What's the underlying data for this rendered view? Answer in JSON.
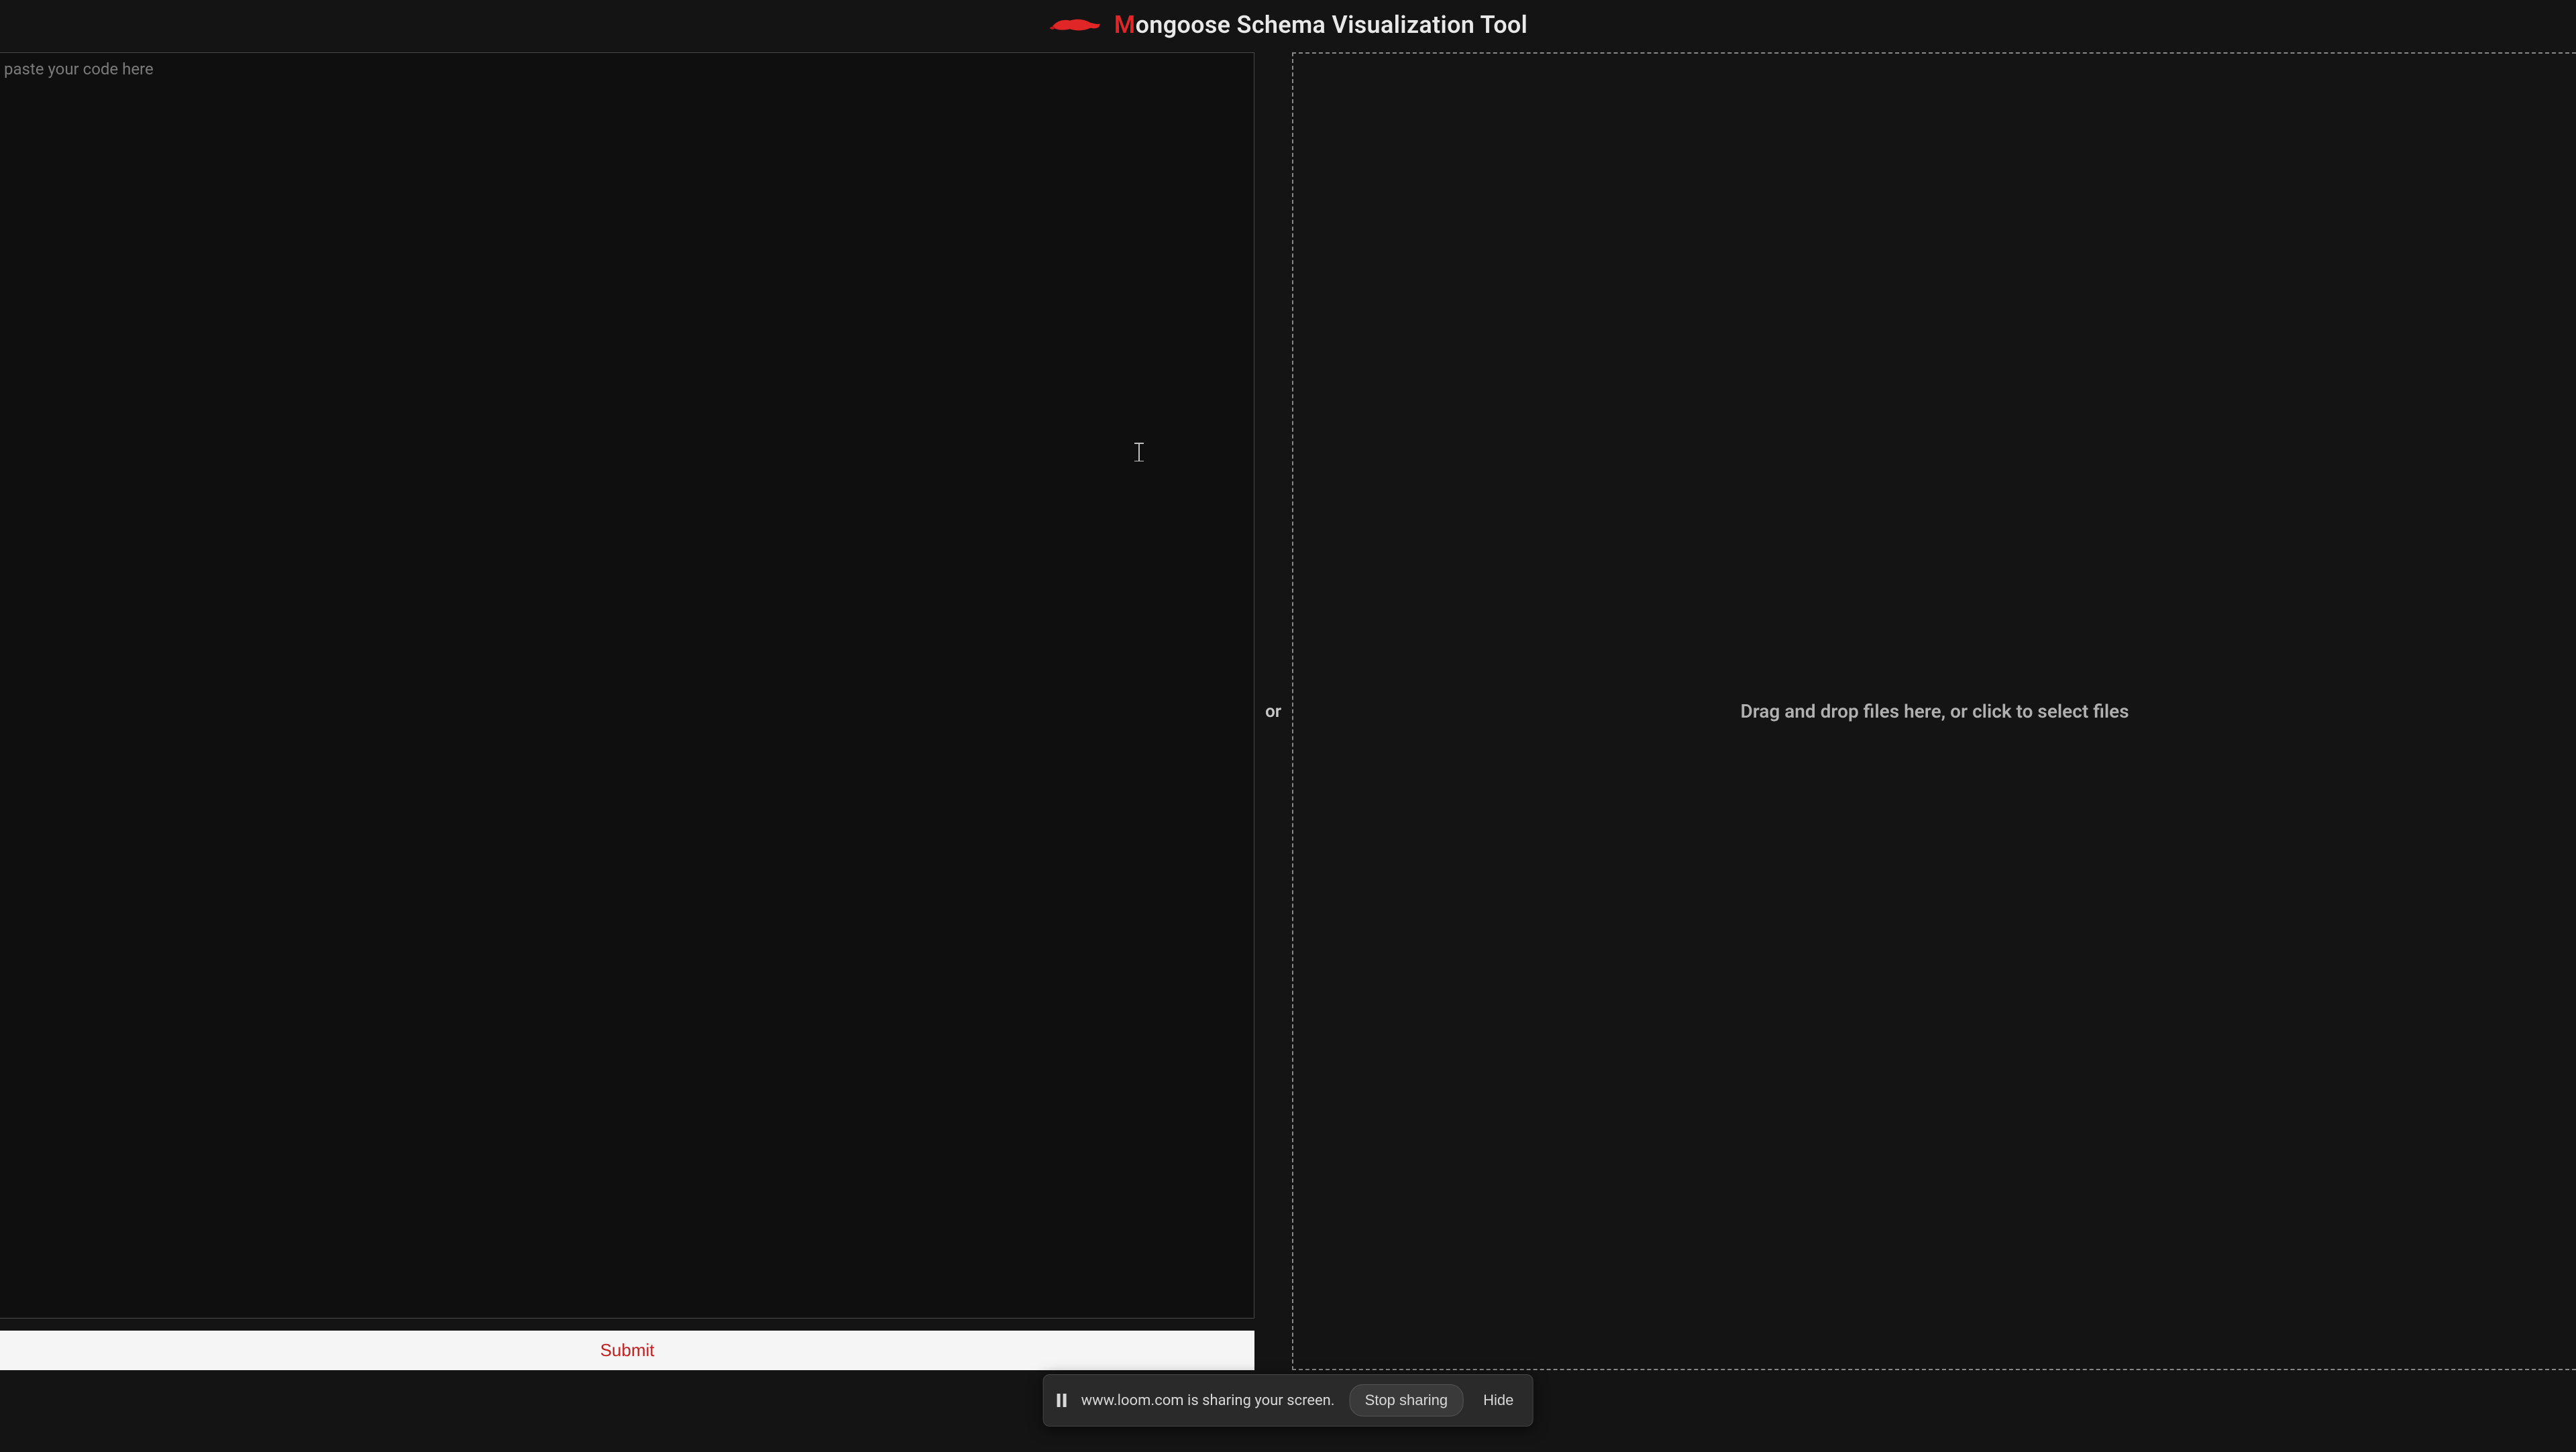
{
  "header": {
    "title_first": "M",
    "title_rest": "ongoose Schema Visualization Tool"
  },
  "left": {
    "placeholder": "paste your code here",
    "submit_label": "Submit"
  },
  "separator": "or",
  "right": {
    "drop_text": "Drag and drop files here, or click to select files"
  },
  "share_bar": {
    "message": "www.loom.com is sharing your screen.",
    "stop_label": "Stop sharing",
    "hide_label": "Hide"
  },
  "colors": {
    "accent": "#e02626",
    "background": "#141414"
  }
}
